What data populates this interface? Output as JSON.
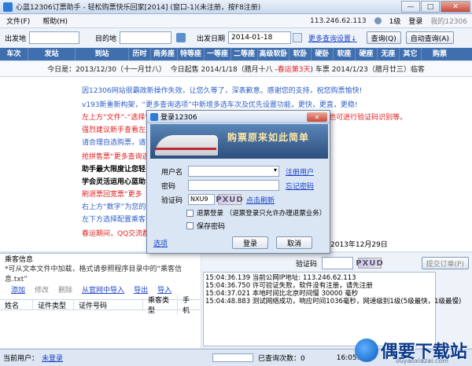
{
  "window": {
    "title": "心蓝12306订票助手 - 轻松购票快乐回家[2014] (窗口-1)(未注册，按F8注册)",
    "min": "—",
    "max": "□",
    "close": "✕"
  },
  "menu": {
    "file": "文件(F)",
    "help": "帮助(H)",
    "ip": "113.246.62.113",
    "level": "1级",
    "login": "登录",
    "my12306": "我的12306",
    "user_icon": "person-icon"
  },
  "search": {
    "from_label": "出发地",
    "to_label": "目的地",
    "date_label": "出发日期",
    "date_value": "2014-01-18",
    "more_link": "更多查询设置↓",
    "query": "查询(Q)",
    "auto_query": "自动查询(A)"
  },
  "table": {
    "columns": [
      "车次",
      "发站",
      "到站",
      "历时",
      "商务座",
      "特等座",
      "一等座",
      "二等座",
      "高级软卧",
      "软卧",
      "硬卧",
      "软座",
      "硬座",
      "无座",
      "其它",
      "购票"
    ]
  },
  "infobar": {
    "prefix": "今日是：2013/12/30（十一月廿八）",
    "mid": "今日起售 2014/1/18（腊月十八 -",
    "highlight": "春运第3天",
    "suffix": ") 车票 2014/1/23（腊月廿三）临客"
  },
  "notices": [
    {
      "text": "因12306网站很霸政新操作失效，让您久等了，深表歉意。感谢您的支持，祝您购票愉快!",
      "color": "blue"
    },
    {
      "text": "v193新重新构架，“更多查询选项”中新增多选车次及优先设置功能，更快，更直，更稳!",
      "color": "blue"
    },
    {
      "text": "左上方“文件”-“选择”可自选查询方式，可以在“设置”中开启，“进入”-“进阶”，也可进行验证码识别等。",
      "color": "red"
    },
    {
      "text": "强烈建议新手查看左上方",
      "color": "red"
    },
    {
      "text": "请合理自选购票，请不要",
      "color": "blue"
    },
    {
      "text": "抢拼售票“更多查询选项”",
      "color": "red"
    },
    {
      "text": "助手最大限度让您轻",
      "color": "bold"
    },
    {
      "text": "学会灵活运用心蓝助",
      "color": "bold"
    },
    {
      "text": "刷退票回宽票“更多",
      "color": "red"
    },
    {
      "text": "右上方“数字”为您的",
      "color": "blue"
    },
    {
      "text": "左下方选择配置乘客",
      "color": "blue"
    },
    {
      "text": "春运期间，QQ交流群",
      "color": "red"
    }
  ],
  "notice_date": "2013年12月29日",
  "passenger": {
    "title": "乘客信息",
    "tip": "*可从文本文件中加载，格式请参照程序目录中的“乘客信息.txt”",
    "add": "添加",
    "edit": "修改",
    "delete": "删除",
    "import_web": "从官网中导入",
    "export": "导出",
    "import": "导入",
    "columns": [
      "姓名",
      "证件类型",
      "证件号码",
      "乘客类型",
      "手机"
    ]
  },
  "captcha": {
    "label": "验证码",
    "image_text": "PXUD",
    "submit": "提交订单(P)"
  },
  "log": [
    "15:04:36.139 当前公网IP地址: 113.246.62.113",
    "15:04:36.750 许可验证失败，软件没有注册，请先注册",
    "15:04:37.021 本地时间比北京时间慢 30000 毫秒",
    "15:04:48.883 测试网络成功，响应时间1036毫秒，网速级别1级(5级最快，1级最慢)"
  ],
  "status": {
    "user_label": "当前用户：",
    "user_link": "未登录",
    "query_count": "已查询次数：0",
    "time": "16:05:10"
  },
  "dialog": {
    "title": "登录12306",
    "close": "✕",
    "slogan": "购票原来如此简单",
    "user_label": "用户名",
    "reg_link": "注册用户",
    "pwd_label": "密码",
    "forgot_link": "忘记密码",
    "code_label": "验证码",
    "code_value": "NXU9",
    "code_img": "PXUD",
    "refresh": "点击刷新",
    "remember_ticket": "退票登录 （退票登录只允许办理退票业务）",
    "remember_pwd": "保存密码",
    "options": "选项",
    "login": "登录",
    "cancel": "取消"
  },
  "watermark": {
    "brand": "偶要下载站",
    "url": "ouyaoxiazai.com"
  }
}
